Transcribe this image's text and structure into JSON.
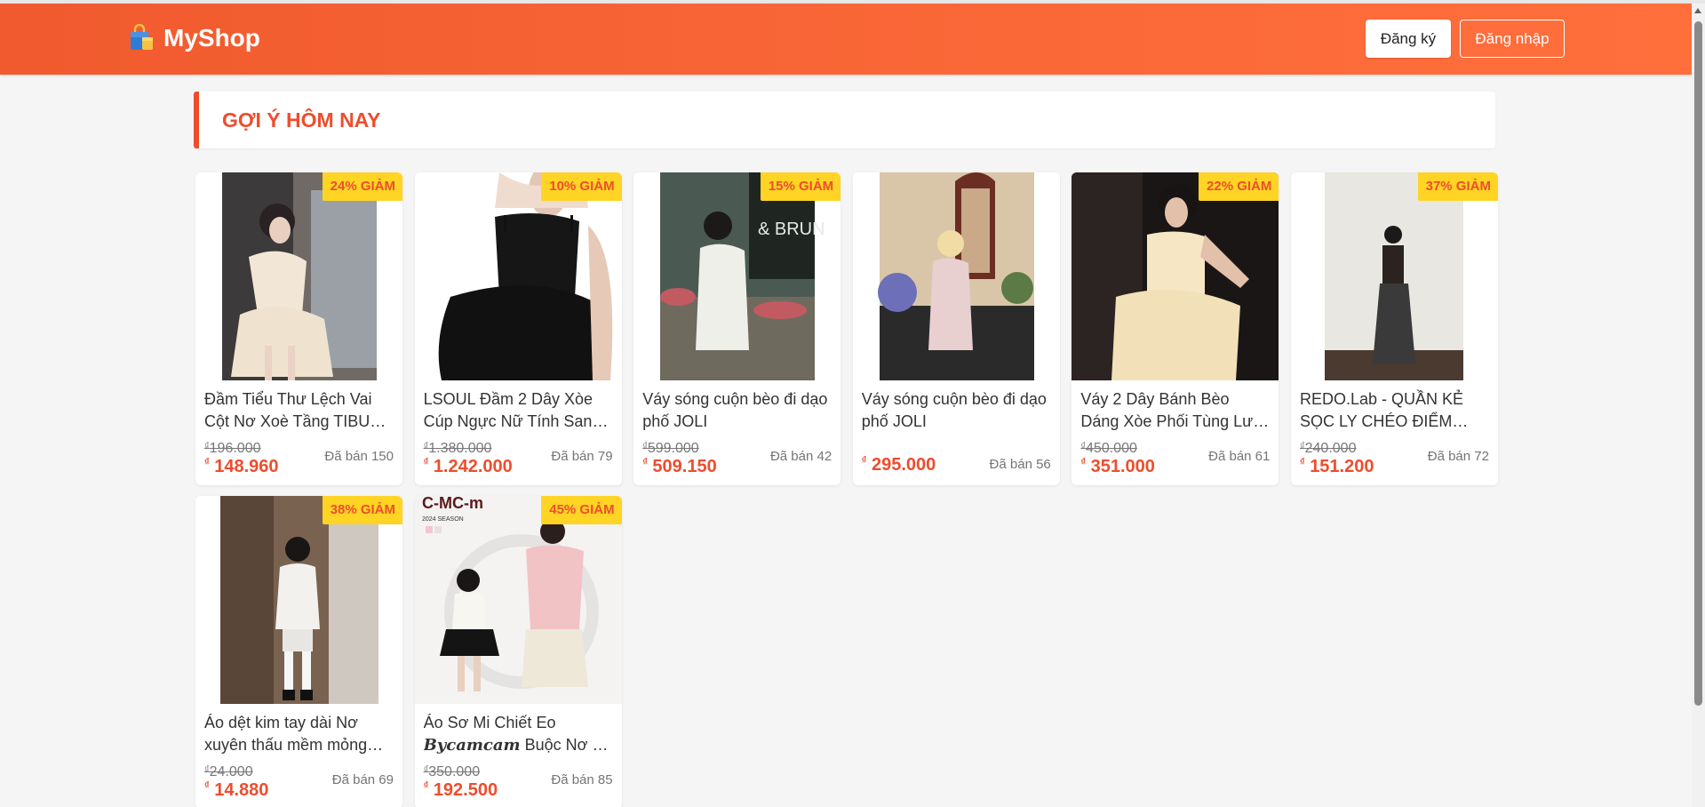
{
  "header": {
    "logo_text": "MyShop",
    "logo_icon": "shopping-bag-icon",
    "register_label": "Đăng ký",
    "login_label": "Đăng nhập"
  },
  "section": {
    "title": "GỢI Ý HÔM NAY"
  },
  "colors": {
    "brand": "#ee4d2d",
    "header_start": "#f05a2e",
    "header_end": "#ff6f3c",
    "badge_bg": "#ffd424"
  },
  "currency_symbol": "₫",
  "products": [
    {
      "name": "Đầm Tiểu Thư Lệch Vai Cột Nơ Xoè Tầng TIBU Dress",
      "discount": "24% GIẢM",
      "old_price": "196.000",
      "price": "148.960",
      "sold": "Đã bán 150"
    },
    {
      "name": "LSOUL Đầm 2 Dây Xòe Cúp Ngực Nữ Tính Sang Chảnh",
      "discount": "10% GIẢM",
      "old_price": "1.380.000",
      "price": "1.242.000",
      "sold": "Đã bán 79"
    },
    {
      "name": "Váy sóng cuộn bèo đi dạo phố JOLI",
      "discount": "15% GIẢM",
      "old_price": "599.000",
      "price": "509.150",
      "sold": "Đã bán 42"
    },
    {
      "name": "Váy sóng cuộn bèo đi dạo phố JOLI",
      "discount": "",
      "old_price": "",
      "price": "295.000",
      "sold": "Đã bán 56"
    },
    {
      "name": "Váy 2 Dây Bánh Bèo Dáng Xòe Phối Tùng Lưới Nhẹ Nhàng",
      "discount": "22% GIẢM",
      "old_price": "450.000",
      "price": "351.000",
      "sold": "Đã bán 61"
    },
    {
      "name": "REDO.Lab - QUẦN KẺ SỌC LY CHÉO ĐIỂM NHẤN",
      "discount": "37% GIẢM",
      "old_price": "240.000",
      "price": "151.200",
      "sold": "Đã bán 72"
    },
    {
      "name": "Áo dệt kim tay dài Nơ xuyên thấu mềm mỏng nhẹ",
      "discount": "38% GIẢM",
      "old_price": "24.000",
      "price": "14.880",
      "sold": "Đã bán 69"
    },
    {
      "name_prefix": "Áo Sơ Mi Chiết Eo",
      "name_brand": "Bycamcam",
      "name_suffix": "Buộc Nơ Cổ Bèo",
      "discount": "45% GIẢM",
      "old_price": "350.000",
      "price": "192.500",
      "sold": "Đã bán 85",
      "image_text": "C-MC-m",
      "image_subtext": "2024 SEASON"
    }
  ]
}
